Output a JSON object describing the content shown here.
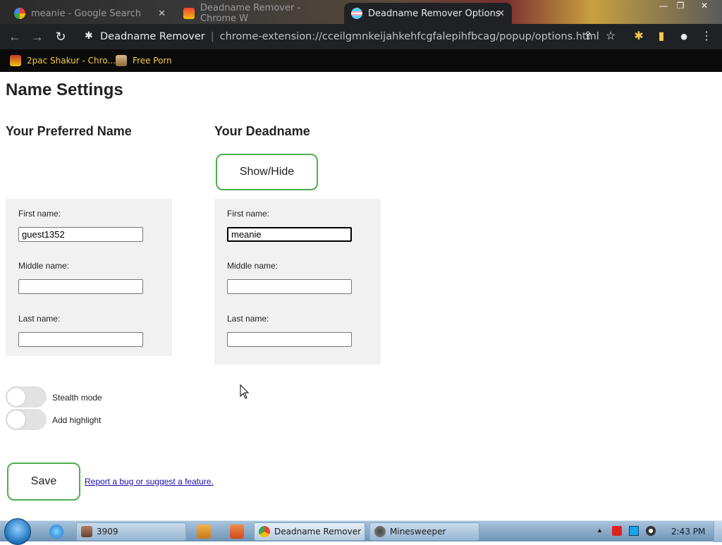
{
  "browser": {
    "tabs": [
      {
        "label": "meanie - Google Search"
      },
      {
        "label": "Deadname Remover - Chrome W"
      },
      {
        "label": "Deadname Remover Options"
      }
    ],
    "tab_close_glyph": "✕",
    "window_controls": {
      "minimize": "—",
      "restore": "❐",
      "close": "✕"
    },
    "nav": {
      "back": "←",
      "forward": "→",
      "reload": "↻"
    },
    "omnibox": {
      "site_name": "Deadname Remover",
      "url": "chrome-extension://cceilgmnkeijahkehfcgfalepihfbcag/popup/options.html"
    },
    "toolbar_icons": {
      "share": "⇪",
      "star": "☆",
      "extensions": "✱",
      "sidepanel": "▮",
      "profile": "●",
      "menu": "⋮"
    },
    "bookmarks": [
      {
        "label": "2pac Shakur - Chro..."
      },
      {
        "label": "Free Porn"
      }
    ]
  },
  "page": {
    "title": "Name Settings",
    "preferred": {
      "heading": "Your Preferred Name",
      "first_label": "First name:",
      "first_value": "guest1352",
      "middle_label": "Middle name:",
      "middle_value": "",
      "last_label": "Last name:",
      "last_value": ""
    },
    "deadname": {
      "heading": "Your Deadname",
      "show_hide_label": "Show/Hide",
      "first_label": "First name:",
      "first_value": "meanie",
      "middle_label": "Middle name:",
      "middle_value": "",
      "last_label": "Last name:",
      "last_value": ""
    },
    "toggles": {
      "stealth_label": "Stealth mode",
      "stealth_on": false,
      "highlight_label": "Add highlight",
      "highlight_on": false
    },
    "save_label": "Save",
    "report_link": "Report a bug or suggest a feature."
  },
  "taskbar": {
    "tasks": [
      {
        "label": "3909"
      },
      {
        "label": "Deadname Remover ..."
      },
      {
        "label": "Minesweeper"
      }
    ],
    "tray_arrow": "▲",
    "clock": "2:43 PM"
  },
  "colors": {
    "accent_green": "#4caf50",
    "chrome_dark": "#202124",
    "bookmark_text": "#f2c94c",
    "link": "#1a0dab"
  }
}
